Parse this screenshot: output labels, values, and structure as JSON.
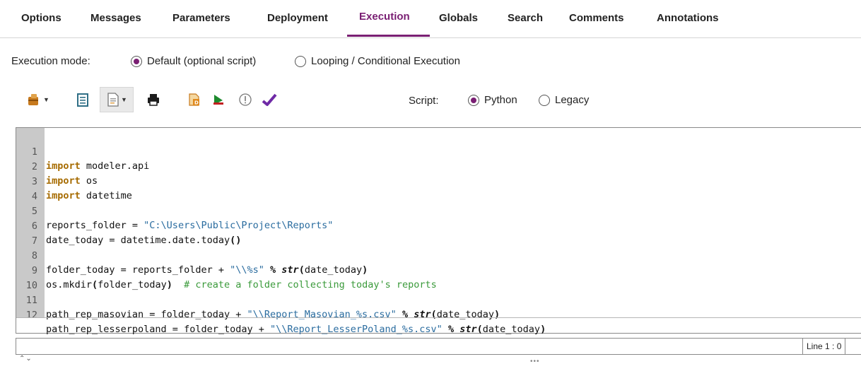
{
  "tabs": [
    {
      "label": "Options"
    },
    {
      "label": "Messages"
    },
    {
      "label": "Parameters"
    },
    {
      "label": "Deployment"
    },
    {
      "label": "Execution"
    },
    {
      "label": "Globals"
    },
    {
      "label": "Search"
    },
    {
      "label": "Comments"
    },
    {
      "label": "Annotations"
    }
  ],
  "active_tab": "Execution",
  "execution_mode": {
    "label": "Execution mode:",
    "options": [
      "Default (optional script)",
      "Looping / Conditional Execution"
    ],
    "selected": "Default (optional script)"
  },
  "script": {
    "label": "Script:",
    "options": [
      "Python",
      "Legacy"
    ],
    "selected": "Python"
  },
  "toolbar": {
    "icons": [
      "open-script-icon",
      "clipboard-icon",
      "script-menu-icon",
      "print-icon",
      "debug-icon",
      "run-icon",
      "check-syntax-icon",
      "done-icon"
    ]
  },
  "code": {
    "line_numbers": [
      "1",
      "2",
      "3",
      "4",
      "5",
      "6",
      "7",
      "8",
      "9",
      "10",
      "11",
      "12"
    ]
  },
  "status": {
    "position": "Line 1 : 0"
  },
  "colors": {
    "accent": "#7a1f73",
    "keyword": "#a66b00",
    "string": "#2a6c9f",
    "comment": "#3a9a3a",
    "gutter": "#c9c9c9"
  }
}
